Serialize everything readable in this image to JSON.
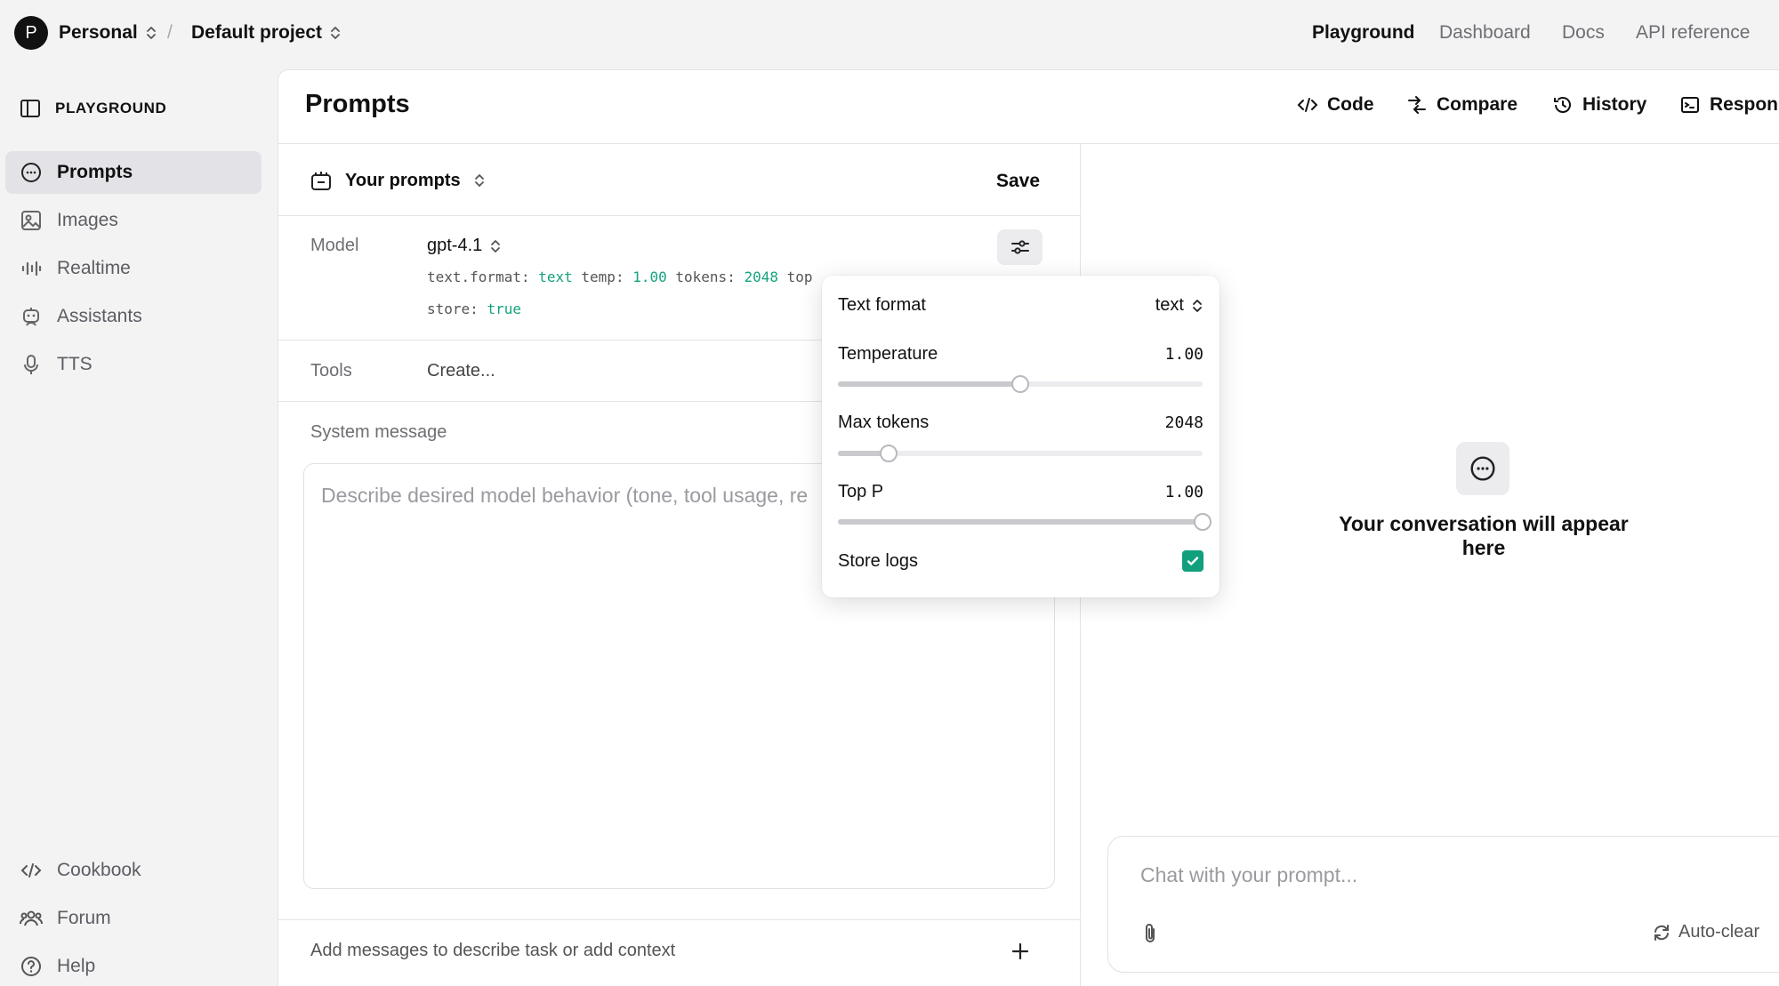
{
  "topbar": {
    "avatar_letter": "P",
    "org": "Personal",
    "separator": "/",
    "project": "Default project",
    "nav": [
      "Playground",
      "Dashboard",
      "Docs",
      "API reference"
    ]
  },
  "sidebar": {
    "heading": "PLAYGROUND",
    "items": [
      {
        "label": "Prompts",
        "icon": "chat-bubble-icon"
      },
      {
        "label": "Images",
        "icon": "image-icon"
      },
      {
        "label": "Realtime",
        "icon": "waveform-icon"
      },
      {
        "label": "Assistants",
        "icon": "robot-icon"
      },
      {
        "label": "TTS",
        "icon": "microphone-icon"
      }
    ],
    "footer": [
      {
        "label": "Cookbook",
        "icon": "code-icon"
      },
      {
        "label": "Forum",
        "icon": "users-icon"
      },
      {
        "label": "Help",
        "icon": "help-icon"
      }
    ]
  },
  "header": {
    "title": "Prompts",
    "actions": [
      "Code",
      "Compare",
      "History",
      "Respons"
    ]
  },
  "prompt": {
    "selector": "Your prompts",
    "save": "Save",
    "model_label": "Model",
    "model": "gpt-4.1",
    "params": {
      "k1": "text.format:",
      "v1": "text",
      "k2": "temp:",
      "v2": "1.00",
      "k3": "tokens:",
      "v3": "2048",
      "k4": "top",
      "k5": "store:",
      "v5": "true"
    },
    "tools_label": "Tools",
    "tools_value": "Create...",
    "system_label": "System message",
    "system_placeholder": "Describe desired model behavior (tone, tool usage, re",
    "add_messages": "Add messages to describe task or add context"
  },
  "settings": {
    "text_format_label": "Text format",
    "text_format_value": "text",
    "temperature_label": "Temperature",
    "temperature_value": "1.00",
    "temperature_level": 0.5,
    "max_tokens_label": "Max tokens",
    "max_tokens_value": "2048",
    "max_tokens_level": 0.14,
    "top_p_label": "Top P",
    "top_p_value": "1.00",
    "top_p_level": 1.0,
    "store_logs_label": "Store logs",
    "store_logs_checked": true
  },
  "conversation": {
    "empty_text": "Your conversation will appear here",
    "chat_placeholder": "Chat with your prompt...",
    "auto_clear": "Auto-clear"
  }
}
